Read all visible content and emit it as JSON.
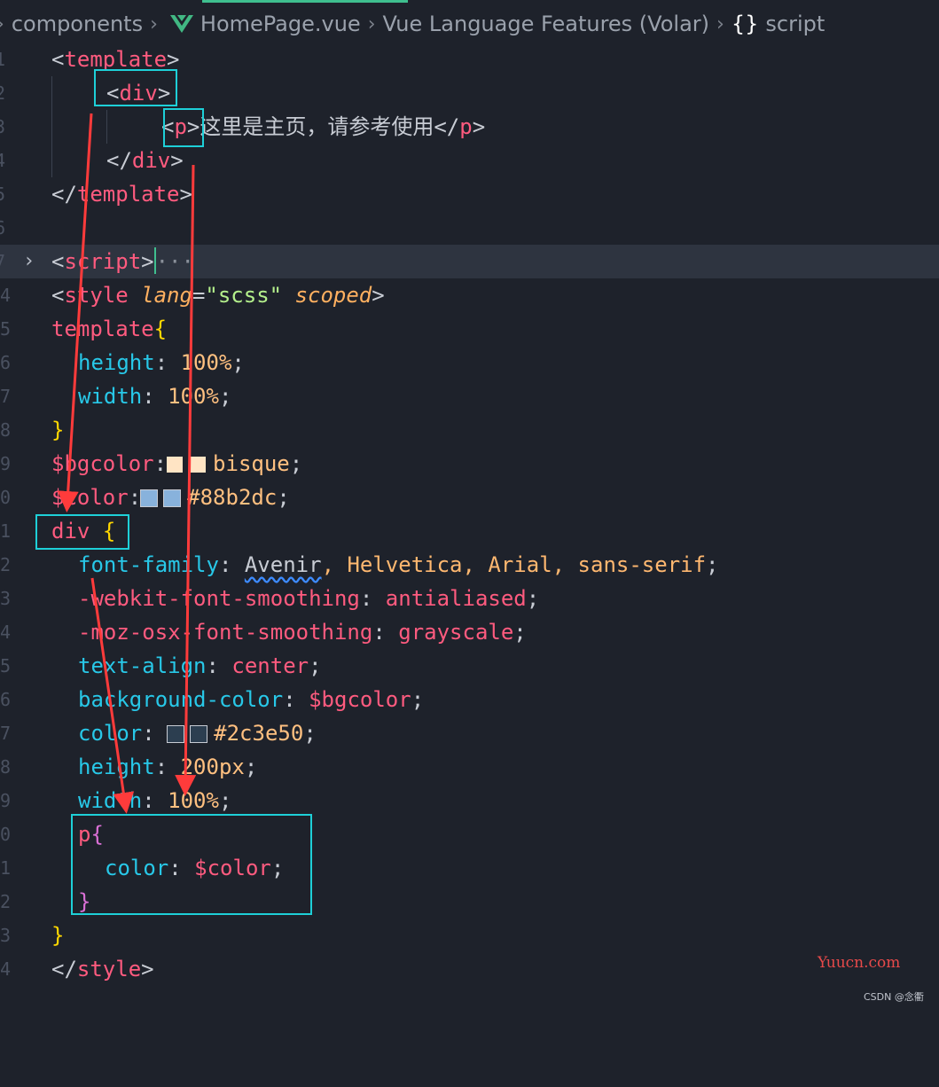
{
  "breadcrumb": {
    "folder": "components",
    "file": "HomePage.vue",
    "language": "Vue Language Features (Volar)",
    "symbol_brace": "{}",
    "symbol": "script"
  },
  "code": {
    "l1": {
      "open": "<",
      "name": "template",
      "close": ">"
    },
    "l2": {
      "open": "<",
      "name": "div",
      "close": ">"
    },
    "l3": {
      "open": "<",
      "name": "p",
      "close": ">",
      "text": "这里是主页，请参考使用",
      "end_open": "</",
      "end_name": "p",
      "end_close": ">"
    },
    "l4": {
      "open": "</",
      "name": "div",
      "close": ">"
    },
    "l5": {
      "open": "</",
      "name": "template",
      "close": ">"
    },
    "l7": {
      "open": "<",
      "name": "script",
      "close": ">",
      "folded": "···"
    },
    "l8": {
      "open": "<",
      "name": "style",
      "attr1": "lang",
      "eq": "=",
      "attr1_val": "\"scss\"",
      "attr2": "scoped",
      "close": ">"
    },
    "l9": {
      "sel": "template",
      "brace": "{"
    },
    "l10": {
      "prop": "height",
      "colon": ": ",
      "val": "100%",
      "semi": ";"
    },
    "l11": {
      "prop": "width",
      "colon": ": ",
      "val": "100%",
      "semi": ";"
    },
    "l12": {
      "brace": "}"
    },
    "l13": {
      "var": "$bgcolor",
      "colon": ":",
      "val": "bisque",
      "semi": ";"
    },
    "l14": {
      "var": "$color",
      "colon": ":",
      "val": "#88b2dc",
      "semi": ";"
    },
    "l15": {
      "sel": "div",
      "brace": "{"
    },
    "l16": {
      "prop": "font-family",
      "colon": ": ",
      "v1": "Avenir",
      "v2": ", Helvetica, Arial, sans-serif",
      "semi": ";"
    },
    "l17": {
      "prop": "-webkit-font-smoothing",
      "colon": ": ",
      "val": "antialiased",
      "semi": ";"
    },
    "l18": {
      "prop": "-moz-osx-font-smoothing",
      "colon": ": ",
      "val": "grayscale",
      "semi": ";"
    },
    "l19": {
      "prop": "text-align",
      "colon": ": ",
      "val": "center",
      "semi": ";"
    },
    "l20": {
      "prop": "background-color",
      "colon": ": ",
      "val": "$bgcolor",
      "semi": ";"
    },
    "l21": {
      "prop": "color",
      "colon": ": ",
      "val": "#2c3e50",
      "semi": ";"
    },
    "l22": {
      "prop": "height",
      "colon": ": ",
      "val": "200px",
      "semi": ";"
    },
    "l23": {
      "prop": "width",
      "colon": ": ",
      "val": "100%",
      "semi": ";"
    },
    "l24": {
      "sel": "p",
      "brace": "{"
    },
    "l25": {
      "prop": "color",
      "colon": ": ",
      "val": "$color",
      "semi": ";"
    },
    "l26": {
      "brace": "}"
    },
    "l27": {
      "brace": "}"
    },
    "l28": {
      "open": "</",
      "name": "style",
      "close": ">"
    }
  },
  "swatches": {
    "bgcolor": "#ffe4c4",
    "color": "#88b2dc",
    "text": "#2c3e50"
  },
  "watermark": {
    "site": "Yuucn.com",
    "credit": "CSDN @念衢"
  }
}
